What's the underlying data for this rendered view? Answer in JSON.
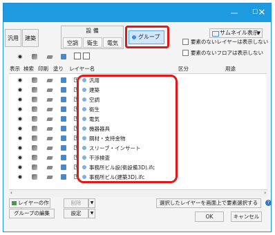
{
  "window": {
    "minimize_glyph": "—",
    "maximize_glyph": "☐",
    "close_glyph": "✕",
    "accent": "#1e9ae0"
  },
  "toolbar": {
    "tab_general": "汎用",
    "tab_building": "建築",
    "equipment_title": "設 備",
    "subtabs": [
      "空調",
      "衛生",
      "電気"
    ],
    "group_button": "グループ",
    "thumbnail_button": "サムネイル表示",
    "checkbox_hide_empty_layers": "要素のないレイヤーは表示しない",
    "checkbox_hide_empty_floors": "要素のないフロアは表示しない"
  },
  "table": {
    "headers": [
      "表示",
      "検索",
      "印刷",
      "塗り",
      "レイヤー名",
      "区分",
      "用途"
    ],
    "rows": [
      {
        "name": "汎用"
      },
      {
        "name": "建築"
      },
      {
        "name": "空調"
      },
      {
        "name": "衛生"
      },
      {
        "name": "電気"
      },
      {
        "name": "機器器具"
      },
      {
        "name": "鋼材・支持金物"
      },
      {
        "name": "スリーブ・インサート"
      },
      {
        "name": "干渉検査"
      },
      {
        "name": "事務所ビル設(衛設備3D).ifc"
      },
      {
        "name": "事務所ビル(建築3D).ifc"
      }
    ]
  },
  "buttons": {
    "create_layer": "レイヤーの作成",
    "delete": "削除",
    "group_edit": "グループの編集",
    "settings": "設定",
    "select_on_screen": "選択したレイヤーを画面上で要素選択する",
    "ok": "OK",
    "cancel": "キャンセル",
    "dropdown_glyph": "▼",
    "help_glyph": "?"
  },
  "highlight_color": "#e01818"
}
